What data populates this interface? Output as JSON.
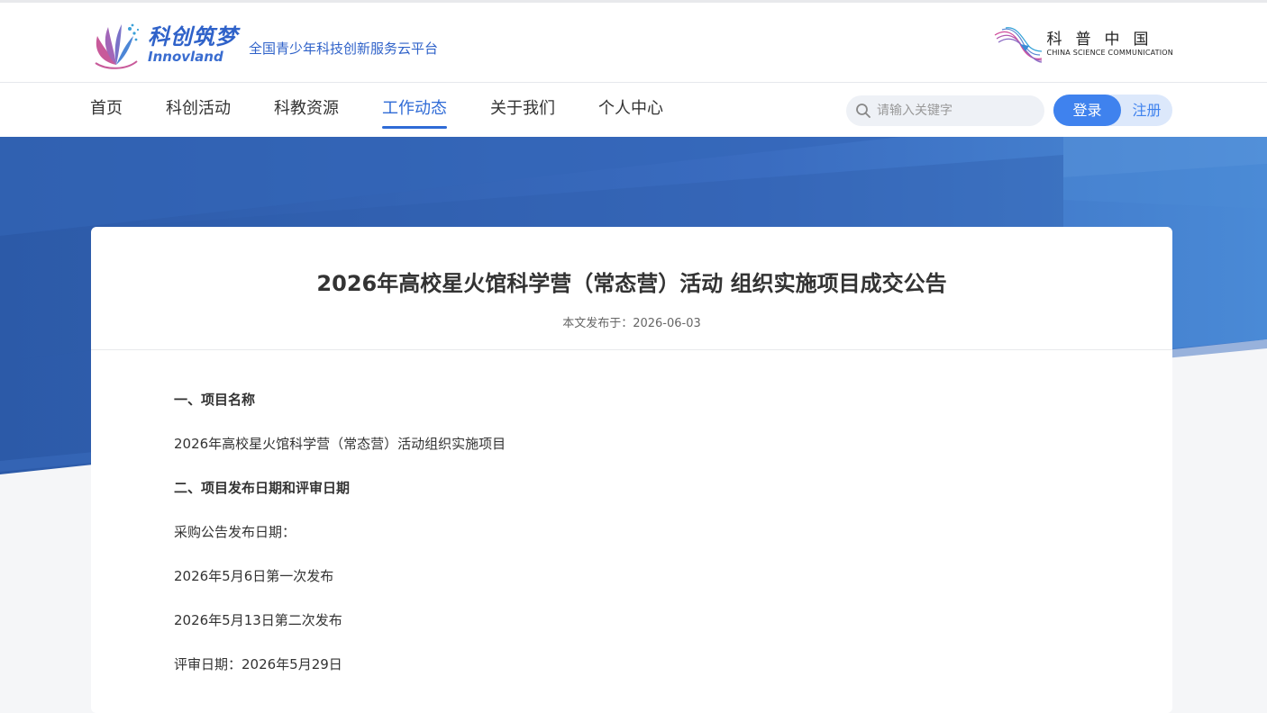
{
  "header": {
    "logo_cn": "科创筑梦",
    "logo_en": "Innovland",
    "slogan": "全国青少年科技创新服务云平台",
    "partner_cn": "科普中国",
    "partner_en": "CHINA SCIENCE COMMUNICATION"
  },
  "nav": {
    "items": [
      {
        "label": "首页"
      },
      {
        "label": "科创活动"
      },
      {
        "label": "科教资源"
      },
      {
        "label": "工作动态"
      },
      {
        "label": "关于我们"
      },
      {
        "label": "个人中心"
      }
    ],
    "active": "工作动态",
    "search_placeholder": "请输入关键字",
    "login_label": "登录",
    "register_label": "注册"
  },
  "article": {
    "title": "2026年高校星火馆科学营（常态营）活动 组织实施项目成交公告",
    "publish_prefix": "本文发布于：",
    "publish_date": "2026-06-03",
    "paragraphs": [
      {
        "text": "一、项目名称",
        "bold": true
      },
      {
        "text": "2026年高校星火馆科学营（常态营）活动组织实施项目",
        "bold": false
      },
      {
        "text": "二、项目发布日期和评审日期",
        "bold": true
      },
      {
        "text": "采购公告发布日期：",
        "bold": false
      },
      {
        "text": "2026年5月6日第一次发布",
        "bold": false
      },
      {
        "text": "2026年5月13日第二次发布",
        "bold": false
      },
      {
        "text": "评审日期：2026年5月29日",
        "bold": false
      }
    ]
  },
  "colors": {
    "brand_blue": "#2f6bd6",
    "button_blue": "#3f82ee",
    "banner_blue": "#3060b0"
  },
  "icons": {
    "search": "search-icon",
    "logo": "innovland-logo-icon",
    "partner": "kepu-logo-icon"
  }
}
